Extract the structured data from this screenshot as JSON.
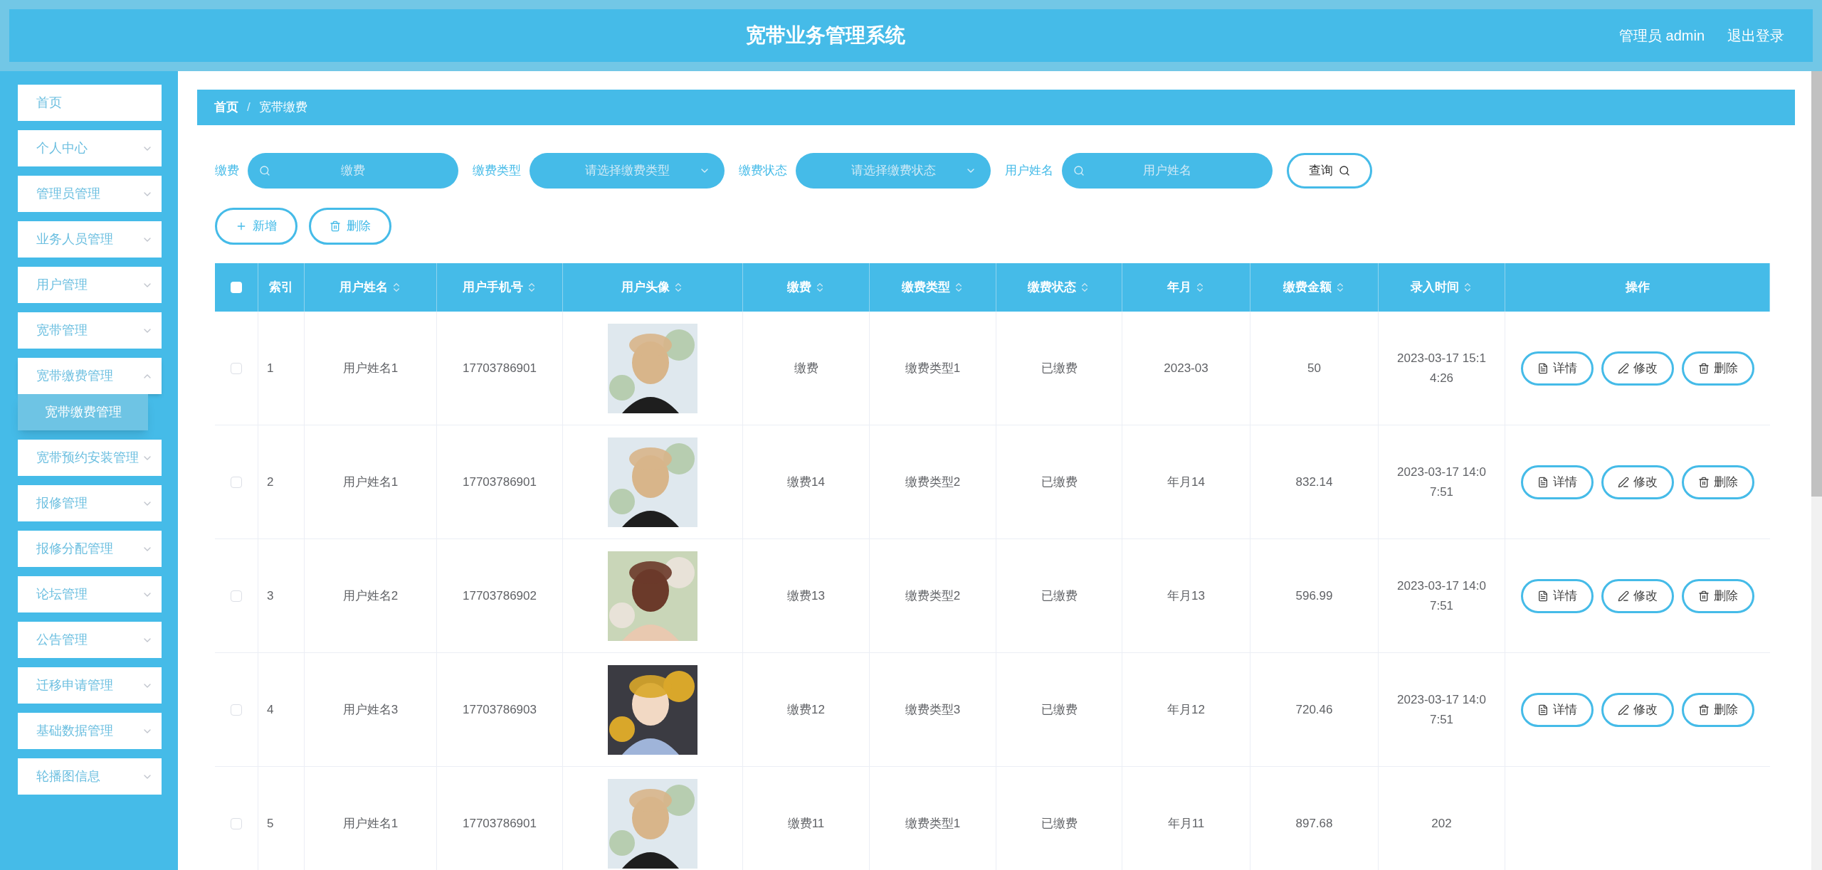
{
  "header": {
    "title": "宽带业务管理系统",
    "user": "管理员 admin",
    "logout": "退出登录"
  },
  "sidebar": {
    "items": [
      {
        "label": "首页",
        "expandable": false,
        "expanded": false
      },
      {
        "label": "个人中心",
        "expandable": true,
        "expanded": false
      },
      {
        "label": "管理员管理",
        "expandable": true,
        "expanded": false
      },
      {
        "label": "业务人员管理",
        "expandable": true,
        "expanded": false
      },
      {
        "label": "用户管理",
        "expandable": true,
        "expanded": false
      },
      {
        "label": "宽带管理",
        "expandable": true,
        "expanded": false
      },
      {
        "label": "宽带缴费管理",
        "expandable": true,
        "expanded": true,
        "children": [
          {
            "label": "宽带缴费管理",
            "selected": true
          }
        ]
      },
      {
        "label": "宽带预约安装管理",
        "expandable": true,
        "expanded": false
      },
      {
        "label": "报修管理",
        "expandable": true,
        "expanded": false
      },
      {
        "label": "报修分配管理",
        "expandable": true,
        "expanded": false
      },
      {
        "label": "论坛管理",
        "expandable": true,
        "expanded": false
      },
      {
        "label": "公告管理",
        "expandable": true,
        "expanded": false
      },
      {
        "label": "迁移申请管理",
        "expandable": true,
        "expanded": false
      },
      {
        "label": "基础数据管理",
        "expandable": true,
        "expanded": false
      },
      {
        "label": "轮播图信息",
        "expandable": true,
        "expanded": false
      }
    ]
  },
  "breadcrumb": {
    "separator": "/",
    "items": [
      "首页",
      "宽带缴费"
    ]
  },
  "filters": [
    {
      "kind": "search",
      "label": "缴费",
      "placeholder": "缴费"
    },
    {
      "kind": "select",
      "label": "缴费类型",
      "placeholder": "请选择缴费类型"
    },
    {
      "kind": "select",
      "label": "缴费状态",
      "placeholder": "请选择缴费状态"
    },
    {
      "kind": "search",
      "label": "用户姓名",
      "placeholder": "用户姓名"
    }
  ],
  "query_button": "查询",
  "actions": [
    {
      "kind": "add",
      "label": "新增"
    },
    {
      "kind": "delete",
      "label": "删除"
    }
  ],
  "table": {
    "select_all_checked": false,
    "columns": [
      {
        "label": "索引",
        "sortable": false
      },
      {
        "label": "用户姓名",
        "sortable": true
      },
      {
        "label": "用户手机号",
        "sortable": true
      },
      {
        "label": "用户头像",
        "sortable": true
      },
      {
        "label": "缴费",
        "sortable": true
      },
      {
        "label": "缴费类型",
        "sortable": true
      },
      {
        "label": "缴费状态",
        "sortable": true
      },
      {
        "label": "年月",
        "sortable": true
      },
      {
        "label": "缴费金额",
        "sortable": true
      },
      {
        "label": "录入时间",
        "sortable": true
      },
      {
        "label": "操作",
        "sortable": false
      }
    ],
    "rows": [
      {
        "checked": false,
        "index": "1",
        "name": "用户姓名1",
        "phone": "17703786901",
        "avatar": {
          "kind": "picture"
        },
        "fee": "缴费",
        "type": "缴费类型1",
        "status": "已缴费",
        "month": "2023-03",
        "amount": "50",
        "time": "2023-03-17 15:1\n4:26",
        "buttons": [
          {
            "kind": "detail",
            "label": "详情"
          },
          {
            "kind": "edit",
            "label": "修改"
          },
          {
            "kind": "delete",
            "label": "删除"
          }
        ]
      },
      {
        "checked": false,
        "index": "2",
        "name": "用户姓名1",
        "phone": "17703786901",
        "avatar": {
          "kind": "picture"
        },
        "fee": "缴费14",
        "type": "缴费类型2",
        "status": "已缴费",
        "month": "年月14",
        "amount": "832.14",
        "time": "2023-03-17 14:0\n7:51",
        "buttons": [
          {
            "kind": "detail",
            "label": "详情"
          },
          {
            "kind": "edit",
            "label": "修改"
          },
          {
            "kind": "delete",
            "label": "删除"
          }
        ]
      },
      {
        "checked": false,
        "index": "3",
        "name": "用户姓名2",
        "phone": "17703786902",
        "avatar": {
          "kind": "picture"
        },
        "fee": "缴费13",
        "type": "缴费类型2",
        "status": "已缴费",
        "month": "年月13",
        "amount": "596.99",
        "time": "2023-03-17 14:0\n7:51",
        "buttons": [
          {
            "kind": "detail",
            "label": "详情"
          },
          {
            "kind": "edit",
            "label": "修改"
          },
          {
            "kind": "delete",
            "label": "删除"
          }
        ]
      },
      {
        "checked": false,
        "index": "4",
        "name": "用户姓名3",
        "phone": "17703786903",
        "avatar": {
          "kind": "picture"
        },
        "fee": "缴费12",
        "type": "缴费类型3",
        "status": "已缴费",
        "month": "年月12",
        "amount": "720.46",
        "time": "2023-03-17 14:0\n7:51",
        "buttons": [
          {
            "kind": "detail",
            "label": "详情"
          },
          {
            "kind": "edit",
            "label": "修改"
          },
          {
            "kind": "delete",
            "label": "删除"
          }
        ]
      },
      {
        "checked": false,
        "index": "5",
        "name": "用户姓名1",
        "phone": "17703786901",
        "avatar": {
          "kind": "picture"
        },
        "fee": "缴费11",
        "type": "缴费类型1",
        "status": "已缴费",
        "month": "年月11",
        "amount": "897.68",
        "time": "202"
      }
    ]
  }
}
